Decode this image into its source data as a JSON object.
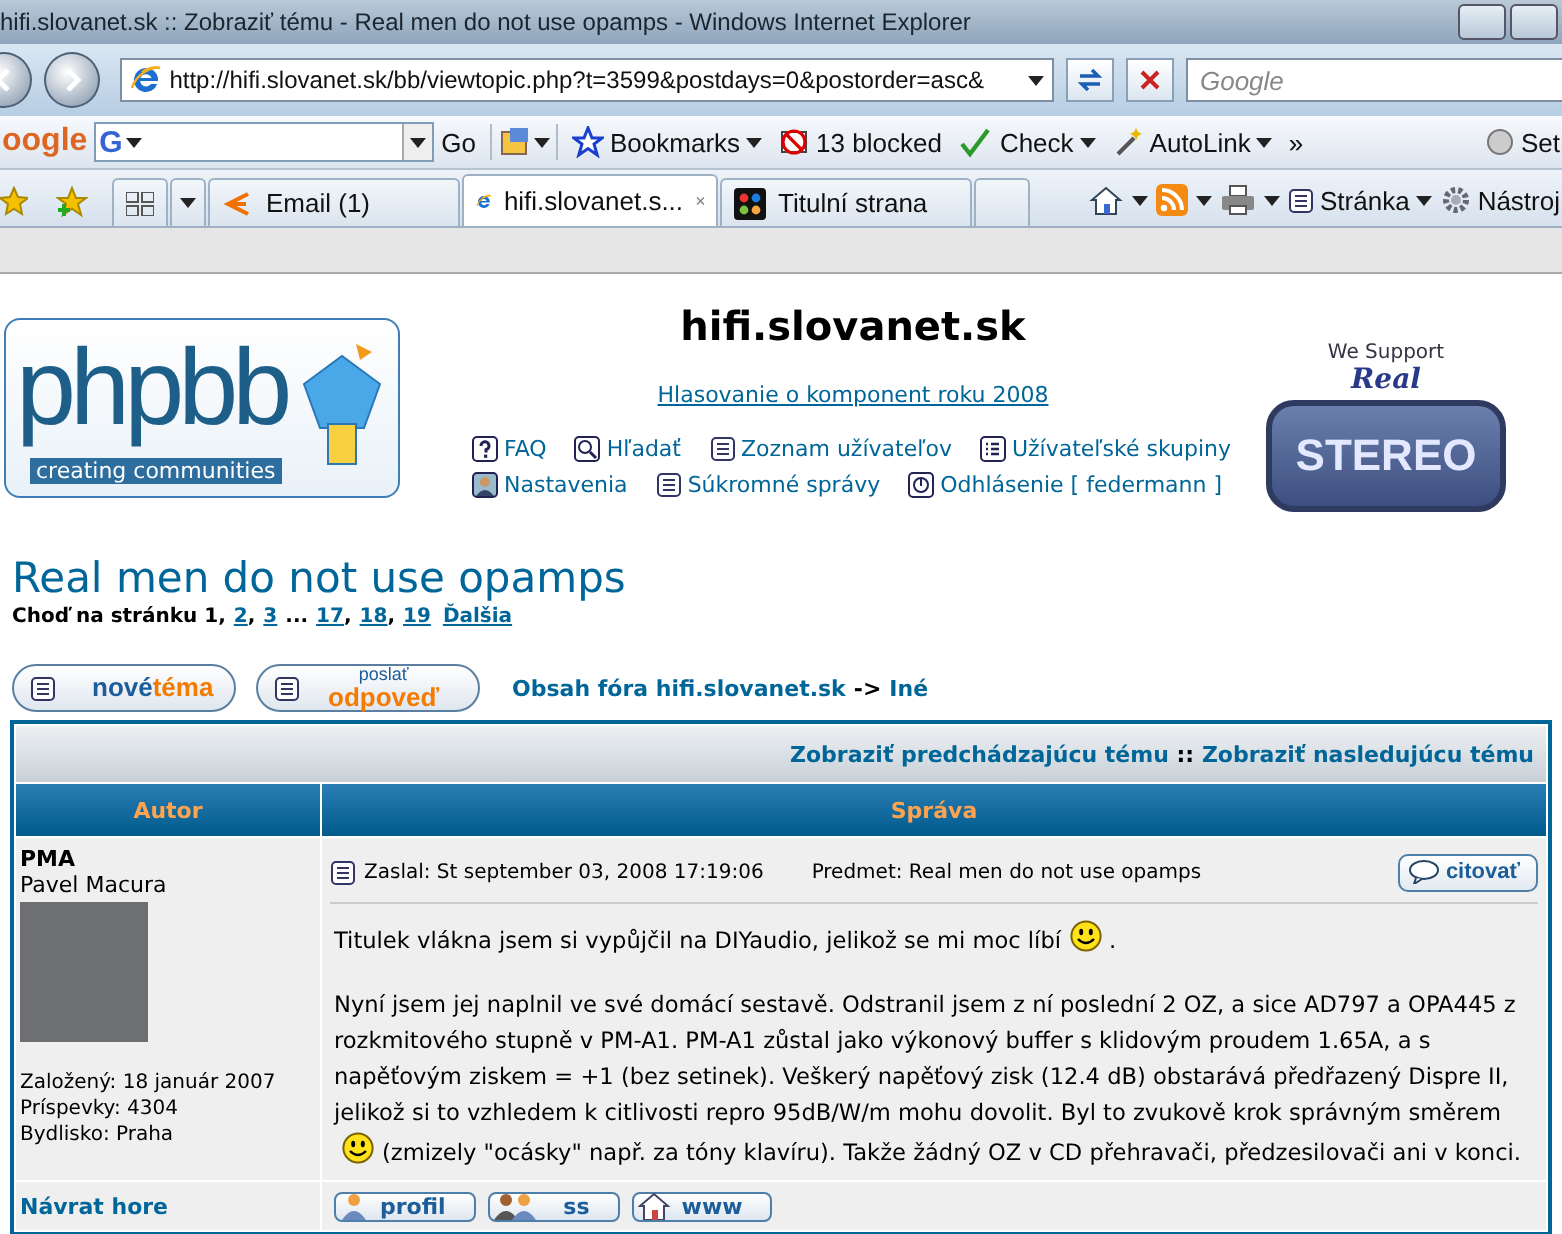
{
  "window": {
    "title": "hifi.slovanet.sk :: Zobraziť tému - Real men do not use opamps - Windows Internet Explorer"
  },
  "address_bar": {
    "url": "http://hifi.slovanet.sk/bb/viewtopic.php?t=3599&postdays=0&postorder=asc&"
  },
  "search_box": {
    "placeholder": "Google"
  },
  "google_toolbar": {
    "logo": "oogle",
    "field_logo": "G",
    "go": "Go",
    "items": [
      {
        "label": "Bookmarks",
        "kind": "bookmarks"
      },
      {
        "label": "13 blocked",
        "kind": "blocked"
      },
      {
        "label": "Check",
        "kind": "check"
      },
      {
        "label": "AutoLink",
        "kind": "autolink"
      }
    ],
    "more": "»",
    "settings": "Set"
  },
  "tabs": [
    {
      "label": "Email (1)",
      "selected": false,
      "kind": "mail"
    },
    {
      "label": "hifi.slovanet.s...",
      "selected": true,
      "kind": "ie"
    },
    {
      "label": "Titulní strana",
      "selected": false,
      "kind": "joomla"
    }
  ],
  "command_bar": {
    "page": "Stránka",
    "tools": "Nástroj"
  },
  "forum": {
    "logo": {
      "wordmark": "phpbb",
      "tagline": "creating communities"
    },
    "site_title": "hifi.slovanet.sk",
    "poll_link": "Hlasovanie o komponent roku 2008",
    "nav": [
      [
        {
          "label": "FAQ",
          "kind": "faq"
        },
        {
          "label": "Hľadať",
          "kind": "search"
        },
        {
          "label": "Zoznam užívateľov",
          "kind": "list"
        },
        {
          "label": "Užívateľské skupiny",
          "kind": "groups"
        }
      ],
      [
        {
          "label": "Nastavenia",
          "kind": "profile"
        },
        {
          "label": "Súkromné správy",
          "kind": "messages"
        },
        {
          "label": "Odhlásenie [ federmann ]",
          "kind": "logout"
        }
      ]
    ],
    "banner": {
      "line1": "We Support",
      "line2": "Real",
      "line3": "STEREO"
    }
  },
  "topic": {
    "title": "Real men do not use opamps",
    "pagination": {
      "label": "Choď na stránku",
      "items": [
        {
          "kind": "page",
          "label": "1",
          "selected": true
        },
        {
          "kind": "sep",
          "label": ","
        },
        {
          "kind": "page",
          "label": "2",
          "selected": false
        },
        {
          "kind": "sep",
          "label": ","
        },
        {
          "kind": "page",
          "label": "3",
          "selected": false
        },
        {
          "kind": "gap",
          "label": "..."
        },
        {
          "kind": "page",
          "label": "17",
          "selected": false
        },
        {
          "kind": "sep",
          "label": ","
        },
        {
          "kind": "page",
          "label": "18",
          "selected": false
        },
        {
          "kind": "sep",
          "label": ","
        },
        {
          "kind": "page",
          "label": "19",
          "selected": false
        },
        {
          "kind": "next",
          "label": "Ďalšia"
        }
      ]
    }
  },
  "actions": {
    "new_topic": [
      "nové",
      "téma"
    ],
    "reply": [
      "poslať",
      "odpoveď"
    ],
    "breadcrumb": [
      {
        "label": "Obsah fóra hifi.slovanet.sk",
        "kind": "link"
      },
      {
        "label": "->",
        "kind": "sep"
      },
      {
        "label": "Iné",
        "kind": "link"
      }
    ]
  },
  "post_table": {
    "nav_links": [
      {
        "label": "Zobraziť predchádzajúcu tému",
        "kind": "link"
      },
      {
        "label": "::",
        "kind": "sep"
      },
      {
        "label": "Zobraziť nasledujúcu tému",
        "kind": "link"
      }
    ],
    "columns": [
      "Autor",
      "Správa"
    ],
    "post": {
      "username": "PMA",
      "real_name": "Pavel Macura",
      "details": [
        "Založený: 18 január 2007",
        "Príspevky: 4304",
        "Bydlisko: Praha"
      ],
      "posted": "Zaslal: St september 03, 2008 17:19:06",
      "subject": "Predmet: Real men do not use opamps",
      "quote_button": "citovať",
      "paragraphs": [
        [
          {
            "kind": "text",
            "text": "Titulek vlákna jsem si vypůjčil na DIYaudio, jelikož se mi moc líbí"
          },
          {
            "kind": "smiley"
          },
          {
            "kind": "text",
            "text": "."
          }
        ],
        [
          {
            "kind": "text",
            "text": "Nyní jsem jej naplnil ve své domácí sestavě. Odstranil jsem z ní poslední 2 OZ, a sice AD797 a OPA445 z rozkmitového stupně v PM-A1. PM-A1 zůstal jako výkonový buffer s klidovým proudem 1.65A, a s napěťovým ziskem = +1 (bez setinek). Veškerý napěťový zisk (12.4 dB) obstarává předřazený Dispre II, jelikož si to vzhledem k citlivosti repro 95dB/W/m mohu dovolit. Byl to zvukově krok správným směrem"
          },
          {
            "kind": "smiley"
          },
          {
            "kind": "text",
            "text": "(zmizely \"ocásky\" např. za tóny klavíru). Takže žádný OZ v CD přehravači, předzesilovači ani v konci."
          }
        ]
      ]
    },
    "back_to_top": "Návrat hore",
    "buttons": [
      {
        "label": "profil",
        "kind": "profile"
      },
      {
        "label": "ss",
        "kind": "pm"
      },
      {
        "label": "www",
        "kind": "www"
      }
    ]
  }
}
